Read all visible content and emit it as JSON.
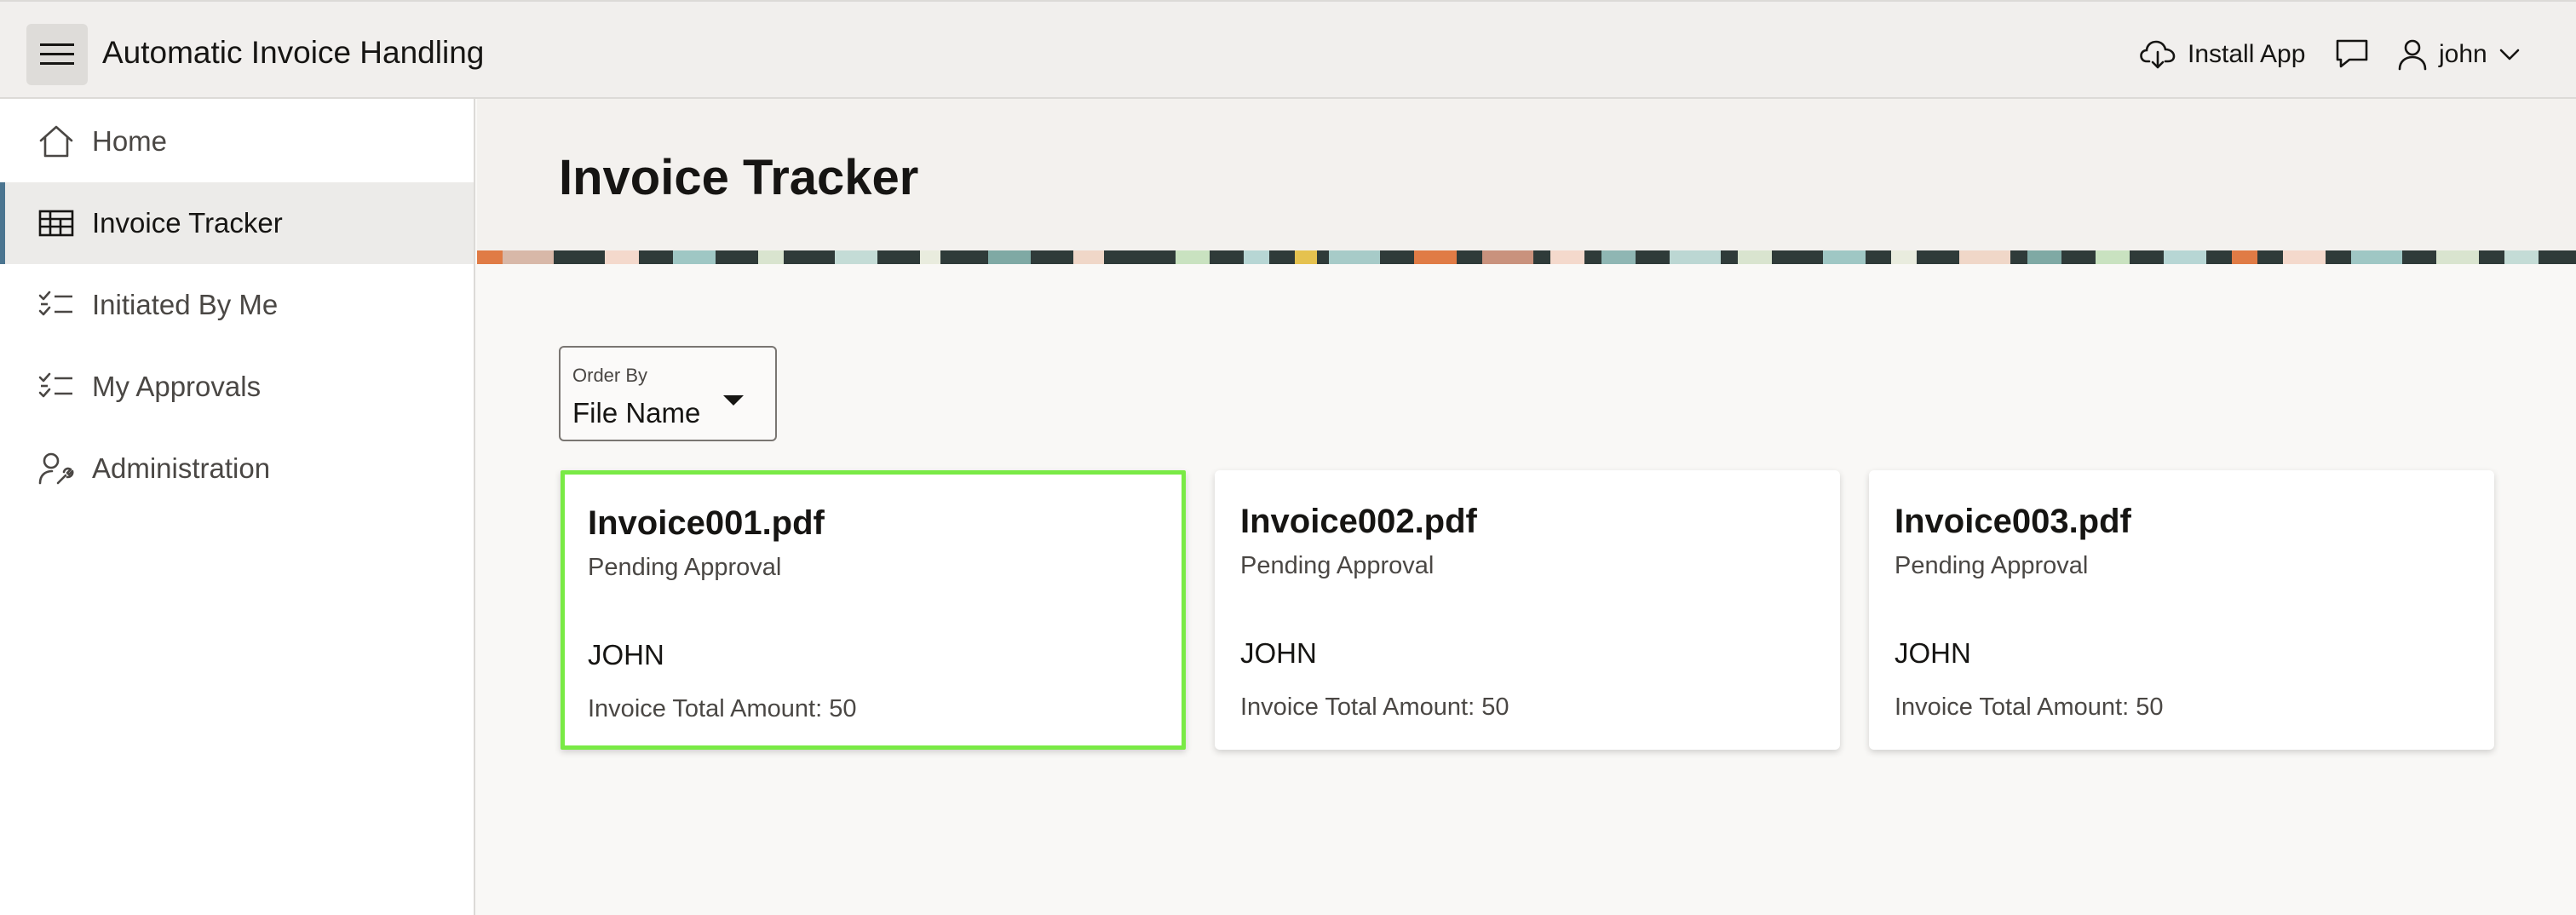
{
  "header": {
    "app_title": "Automatic Invoice Handling",
    "install_app_label": "Install App",
    "user_name": "john"
  },
  "sidebar": {
    "items": [
      {
        "label": "Home",
        "icon": "home-icon"
      },
      {
        "label": "Invoice Tracker",
        "icon": "grid-icon",
        "active": true
      },
      {
        "label": "Initiated By Me",
        "icon": "checklist-icon"
      },
      {
        "label": "My Approvals",
        "icon": "checklist-icon"
      },
      {
        "label": "Administration",
        "icon": "user-wrench-icon"
      }
    ]
  },
  "main": {
    "page_title": "Invoice Tracker",
    "order_by": {
      "label": "Order By",
      "value": "File Name"
    },
    "cards": [
      {
        "file_name": "Invoice001.pdf",
        "status": "Pending Approval",
        "owner": "JOHN",
        "amount": "Invoice Total Amount: 50",
        "selected": true
      },
      {
        "file_name": "Invoice002.pdf",
        "status": "Pending Approval",
        "owner": "JOHN",
        "amount": "Invoice Total Amount: 50"
      },
      {
        "file_name": "Invoice003.pdf",
        "status": "Pending Approval",
        "owner": "JOHN",
        "amount": "Invoice Total Amount: 50"
      }
    ]
  },
  "colors": {
    "active_nav_accent": "#4b7590",
    "selected_card_border": "#79ea45",
    "header_bg": "#f1efed"
  }
}
